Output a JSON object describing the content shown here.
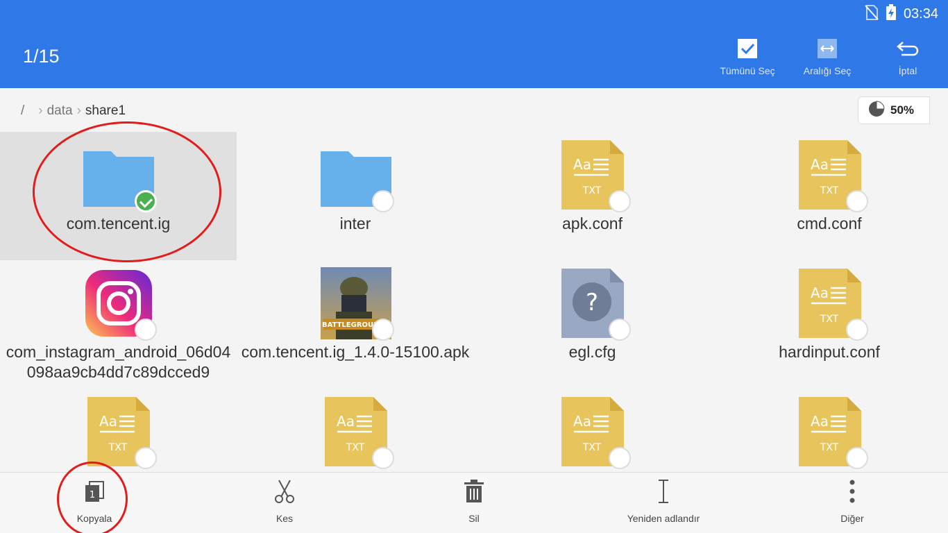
{
  "status": {
    "time": "03:34"
  },
  "header": {
    "counter": "1/15",
    "actions": [
      {
        "label": "Tümünü Seç",
        "icon": "select-all-icon"
      },
      {
        "label": "Aralığı Seç",
        "icon": "select-range-icon"
      },
      {
        "label": "İptal",
        "icon": "cancel-icon"
      }
    ]
  },
  "breadcrumb": {
    "root": "/",
    "path": [
      "data",
      "share1"
    ]
  },
  "storage": {
    "percent": "50%"
  },
  "files": [
    {
      "name": "com.tencent.ig",
      "type": "folder",
      "selected": true
    },
    {
      "name": "inter",
      "type": "folder",
      "selected": false
    },
    {
      "name": "apk.conf",
      "type": "txt",
      "selected": false
    },
    {
      "name": "cmd.conf",
      "type": "txt",
      "selected": false
    },
    {
      "name": "com_instagram_android_06d04098aa9cb4dd7c89dcced9",
      "type": "instagram",
      "selected": false
    },
    {
      "name": "com.tencent.ig_1.4.0-15100.apk",
      "type": "apk",
      "selected": false
    },
    {
      "name": "egl.cfg",
      "type": "unknown",
      "selected": false
    },
    {
      "name": "hardinput.conf",
      "type": "txt",
      "selected": false
    },
    {
      "name": "",
      "type": "txt",
      "selected": false
    },
    {
      "name": "",
      "type": "txt",
      "selected": false
    },
    {
      "name": "",
      "type": "txt",
      "selected": false
    },
    {
      "name": "",
      "type": "txt",
      "selected": false
    }
  ],
  "txt_icon": {
    "top": "Aa",
    "bottom": "TXT"
  },
  "unknown_icon": {
    "glyph": "?"
  },
  "apk_icon": {
    "text": "BATTLEGROUNDS"
  },
  "copy_badge": "1",
  "toolbar": [
    {
      "label": "Kopyala",
      "icon": "copy-icon"
    },
    {
      "label": "Kes",
      "icon": "scissors-icon"
    },
    {
      "label": "Sil",
      "icon": "trash-icon"
    },
    {
      "label": "Yeniden adlandır",
      "icon": "rename-icon"
    },
    {
      "label": "Diğer",
      "icon": "more-icon"
    }
  ],
  "colors": {
    "header": "#2f78e8",
    "folder": "#66b0ec",
    "txt": "#e8c45c",
    "unknown": "#9aa9c3",
    "check": "#4caf50",
    "annotation": "#e21b1b"
  }
}
